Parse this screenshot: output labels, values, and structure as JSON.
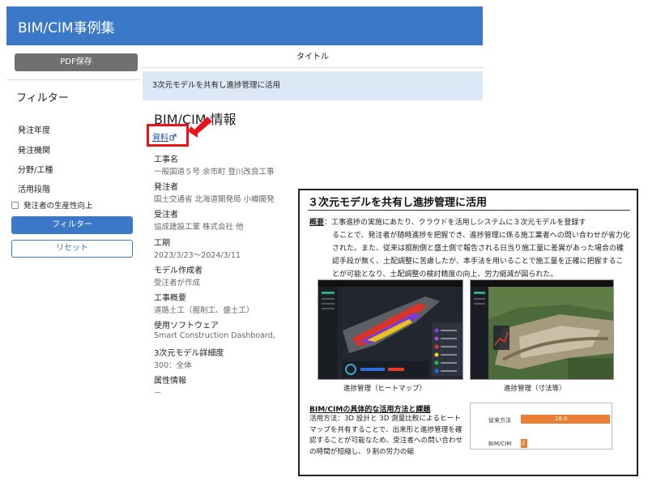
{
  "app": {
    "title": "BIM/CIM事例集"
  },
  "sidebar": {
    "pdf_label": "PDF保存",
    "filter_title": "フィルター",
    "filters": [
      "発注年度",
      "発注機関",
      "分野/工種",
      "活用段階"
    ],
    "check_label": "発注者の生産性向上",
    "filter_button": "フィルター",
    "reset_button": "リセット"
  },
  "main": {
    "column_header": "タイトル",
    "row_title": "3次元モデルを共有し進捗管理に活用",
    "info_heading": "BIM/CIM 情報",
    "doc_link": "資料",
    "fields": [
      {
        "label": "工事名",
        "value": "一般国道５号 余市町 登川改良工事"
      },
      {
        "label": "発注者",
        "value": "国土交通省 北海道開発局 小樽開発"
      },
      {
        "label": "受注者",
        "value": "協成建設工業 株式会社 他"
      },
      {
        "label": "工期",
        "value": "2023/3/23〜2024/3/11"
      },
      {
        "label": "モデル作成者",
        "value": "受注者が作成"
      },
      {
        "label": "工事概要",
        "value": "道路土工（掘削工、盛土工）"
      },
      {
        "label": "使用ソフトウェア",
        "value": "Smart Construction Dashboard, Civil"
      },
      {
        "label": "3次元モデル詳細度",
        "value": "300：全体"
      },
      {
        "label": "属性情報",
        "value": "－"
      }
    ]
  },
  "overlay": {
    "title": "３次元モデルを共有し進捗管理に活用",
    "summary_lead": "概要",
    "summary_line1": "：工事進捗の実施にあたり、クラウドを活用しシステムに３次元モデルを登録す",
    "summary_rest": "ることで、発注者が随時進捗を把握でき、進捗管理に係る施工業者への問い合わせが省力化された。また、従来は掘削側と盛土側で報告される日当り施工量に差異があった場合の確認手段が無く、土配調整に苦慮したが、本手法を用いることで施工量を正確に把握することが可能となり、土配調整の検討精度の向上、労力縮減が図られた。",
    "caption1": "進捗管理（ヒートマップ）",
    "caption2": "進捗管理（寸法等）",
    "subheading": "BIM/CIMの具体的な活用方法と課題",
    "method_text": "活用方法：3D 設計と 3D 測量比較によるヒートマップを共有することで、出来形と進捗管理を確認することが可能なため、受注者への問い合わせの時間が短縮し、９割の労力の縮",
    "bar_labels": [
      "従来方法",
      "BIM/CIM"
    ],
    "bar_value_label": "28.0",
    "bar_value_label2": "2"
  },
  "colors": {
    "header": "#3b78c8",
    "highlight": "#e8141a",
    "bar": "#e97f35"
  },
  "icons": {
    "doc_icon": "external-link-icon",
    "arrow": "red-arrow-icon"
  }
}
